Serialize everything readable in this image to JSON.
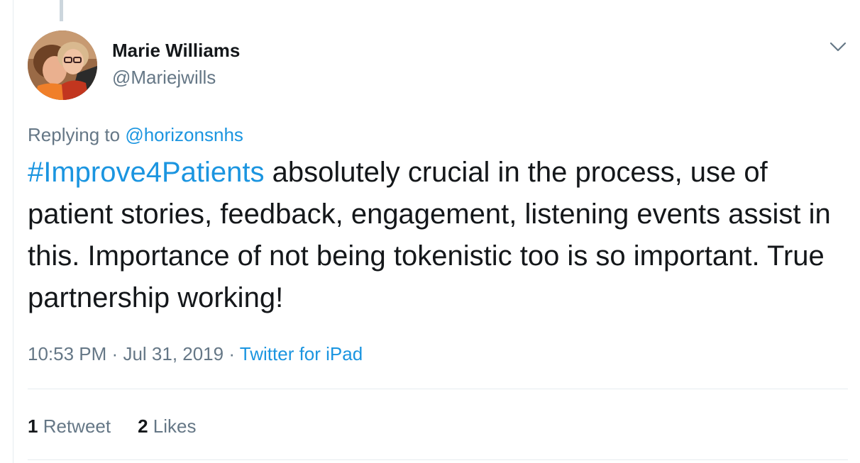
{
  "tweet": {
    "author": {
      "display_name": "Marie Williams",
      "username": "@Mariejwills"
    },
    "replying": {
      "prefix": "Replying to",
      "mention": "@horizonsnhs"
    },
    "hashtag": "#Improve4Patients",
    "text": " absolutely crucial in the process, use of patient stories, feedback, engagement, listening events assist in this. Importance of not being tokenistic too is so important. True partnership working!",
    "time": "10:53 PM",
    "separator": "·",
    "date": "Jul 31, 2019",
    "source": "Twitter for iPad",
    "stats": {
      "retweets_count": "1",
      "retweets_label": "Retweet",
      "likes_count": "2",
      "likes_label": "Likes"
    }
  },
  "icons": {
    "menu": "chevron-down-icon",
    "avatar": "profile-photo"
  },
  "colors": {
    "link": "#1b95e0",
    "text": "#14171a",
    "secondary": "#657786",
    "divider": "#e6ecf0"
  }
}
